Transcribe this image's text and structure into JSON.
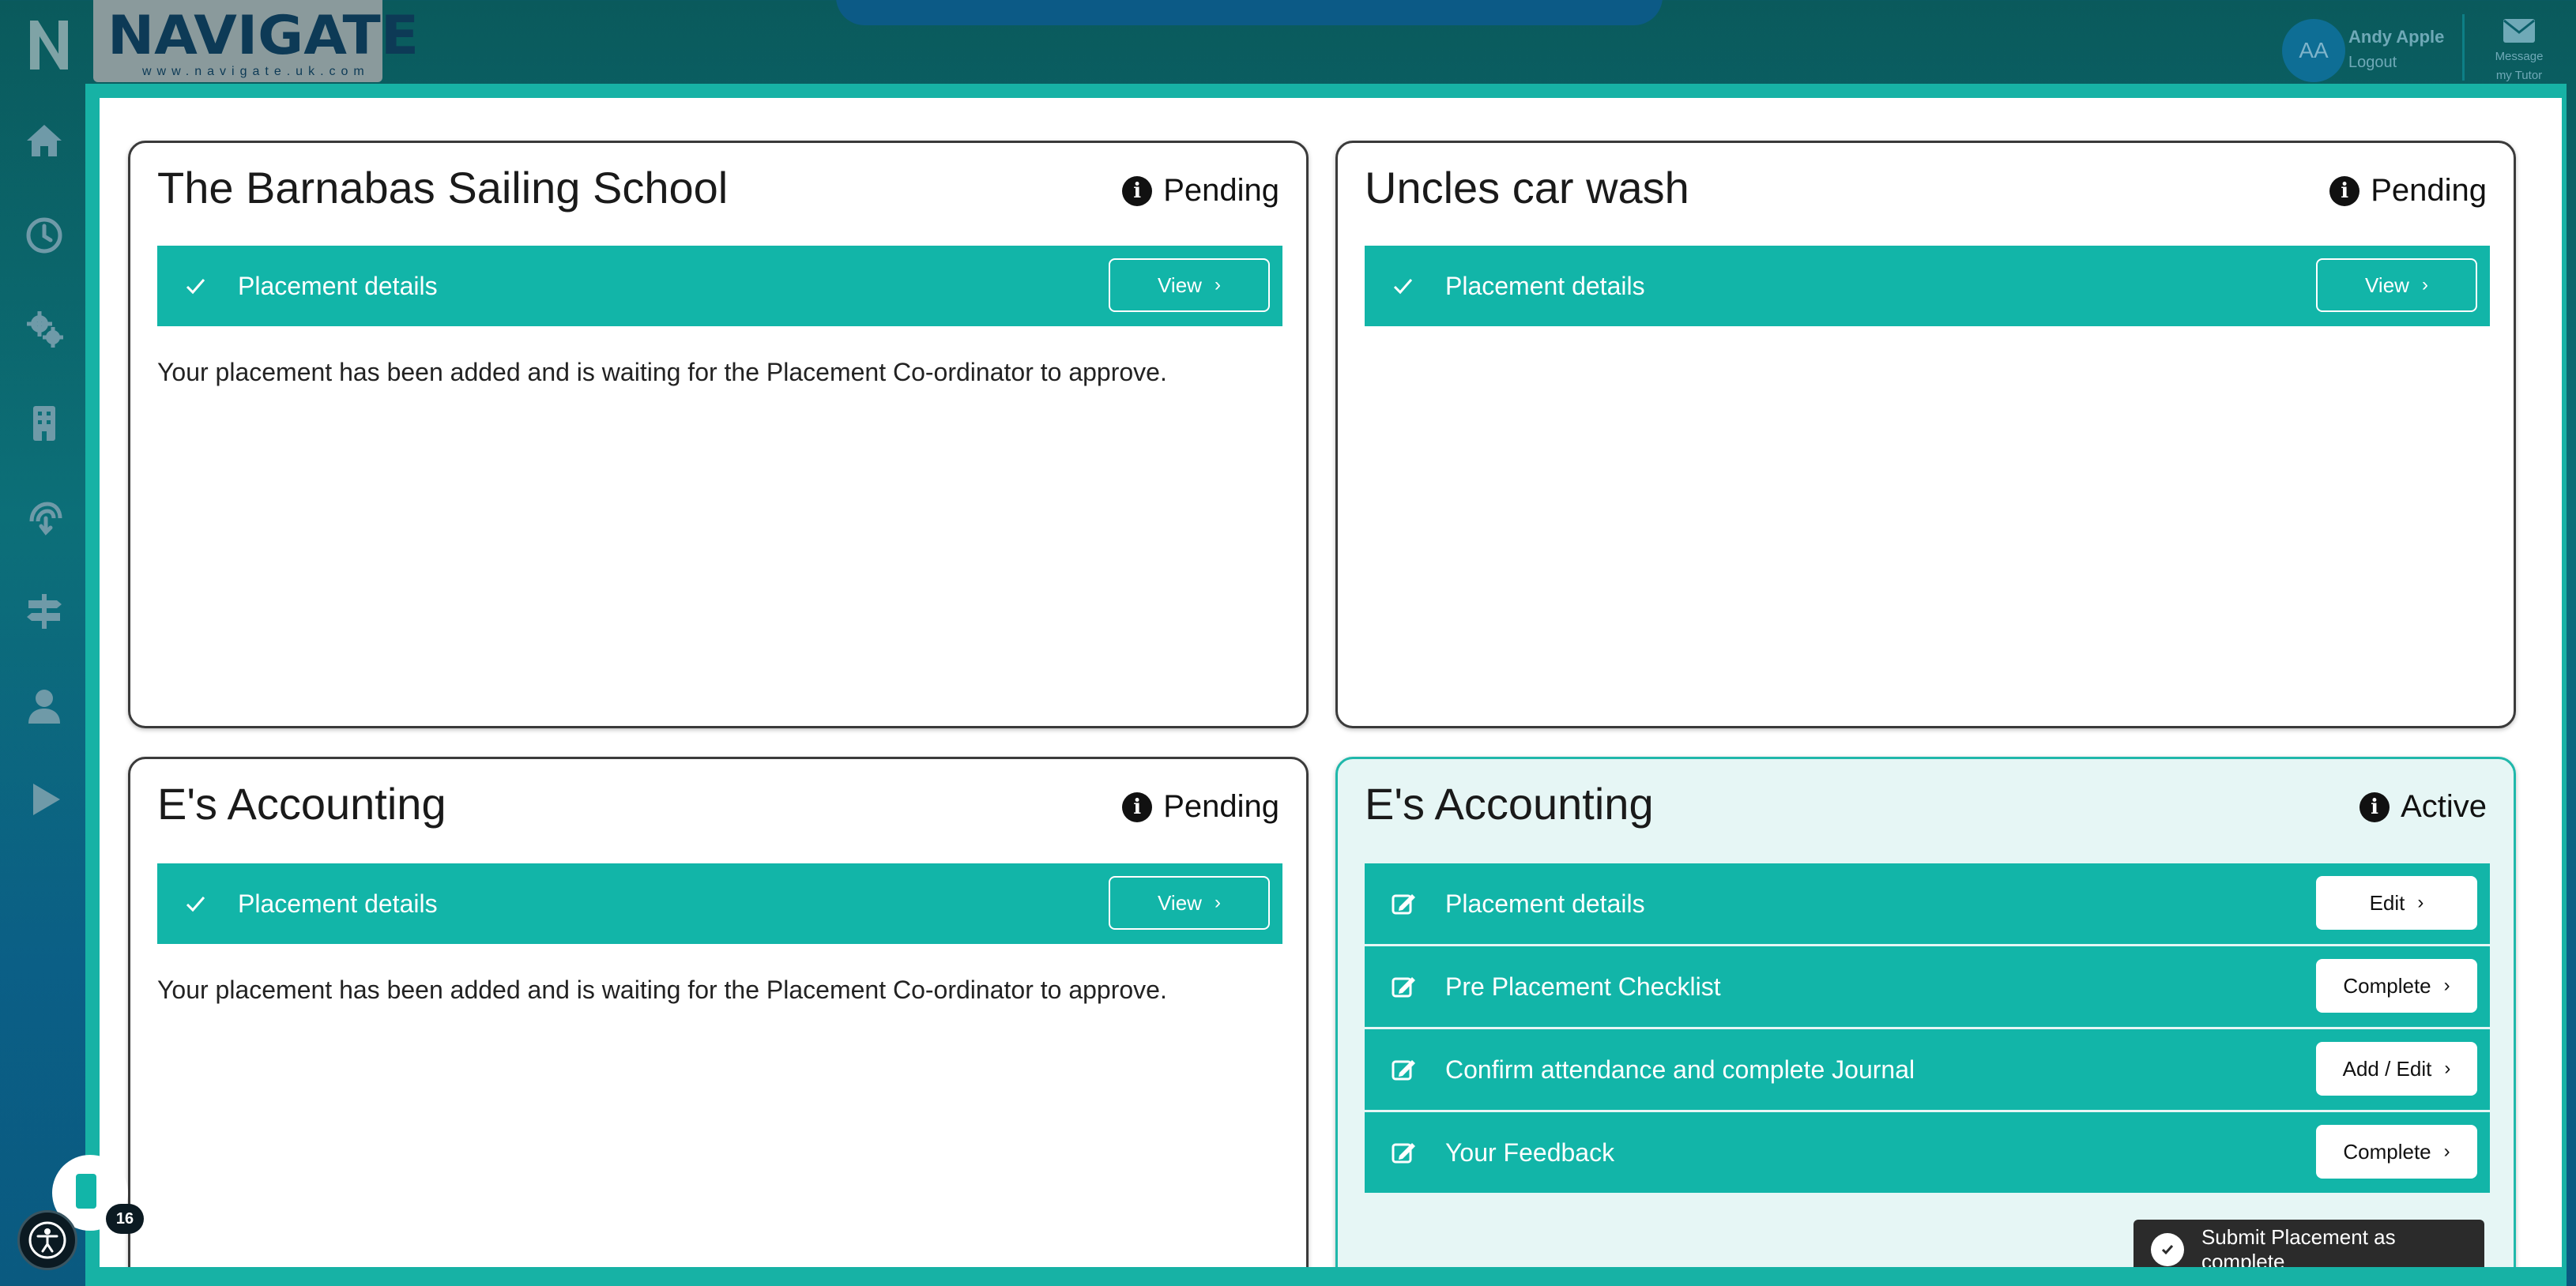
{
  "header": {
    "brand_name": "NAVIGATE",
    "brand_url": "www.navigate.uk.com",
    "user_initials": "AA",
    "user_name": "Andy Apple",
    "logout_label": "Logout",
    "message_label": "Message my Tutor"
  },
  "sidebar": {
    "items": [
      {
        "icon": "home-icon"
      },
      {
        "icon": "clock-icon"
      },
      {
        "icon": "gears-icon"
      },
      {
        "icon": "building-icon"
      },
      {
        "icon": "hand-pointer-icon"
      },
      {
        "icon": "signpost-icon"
      },
      {
        "icon": "user-icon"
      },
      {
        "icon": "play-icon"
      }
    ]
  },
  "chat_badge_count": "16",
  "colors": {
    "teal": "#12b5a8",
    "active_bg": "#e6f6f5",
    "dark": "#2b2b2b"
  },
  "cards": [
    {
      "title": "The Barnabas Sailing School",
      "status": "Pending",
      "rows": [
        {
          "label": "Placement details",
          "button": "View"
        }
      ],
      "message": "Your placement has been added and is waiting for the Placement Co-ordinator to approve."
    },
    {
      "title": "Uncles car wash",
      "status": "Pending",
      "rows": [
        {
          "label": "Placement details",
          "button": "View"
        }
      ],
      "message": ""
    },
    {
      "title": "E's Accounting",
      "status": "Pending",
      "rows": [
        {
          "label": "Placement details",
          "button": "View"
        }
      ],
      "message": "Your placement has been added and is waiting for the Placement Co-ordinator to approve."
    },
    {
      "title": "E's Accounting",
      "status": "Active",
      "rows": [
        {
          "label": "Placement details",
          "button": "Edit"
        },
        {
          "label": "Pre Placement Checklist",
          "button": "Complete"
        },
        {
          "label": "Confirm attendance and complete Journal",
          "button": "Add / Edit"
        },
        {
          "label": "Your Feedback",
          "button": "Complete"
        }
      ]
    }
  ],
  "submit_label": "Submit Placement as complete"
}
